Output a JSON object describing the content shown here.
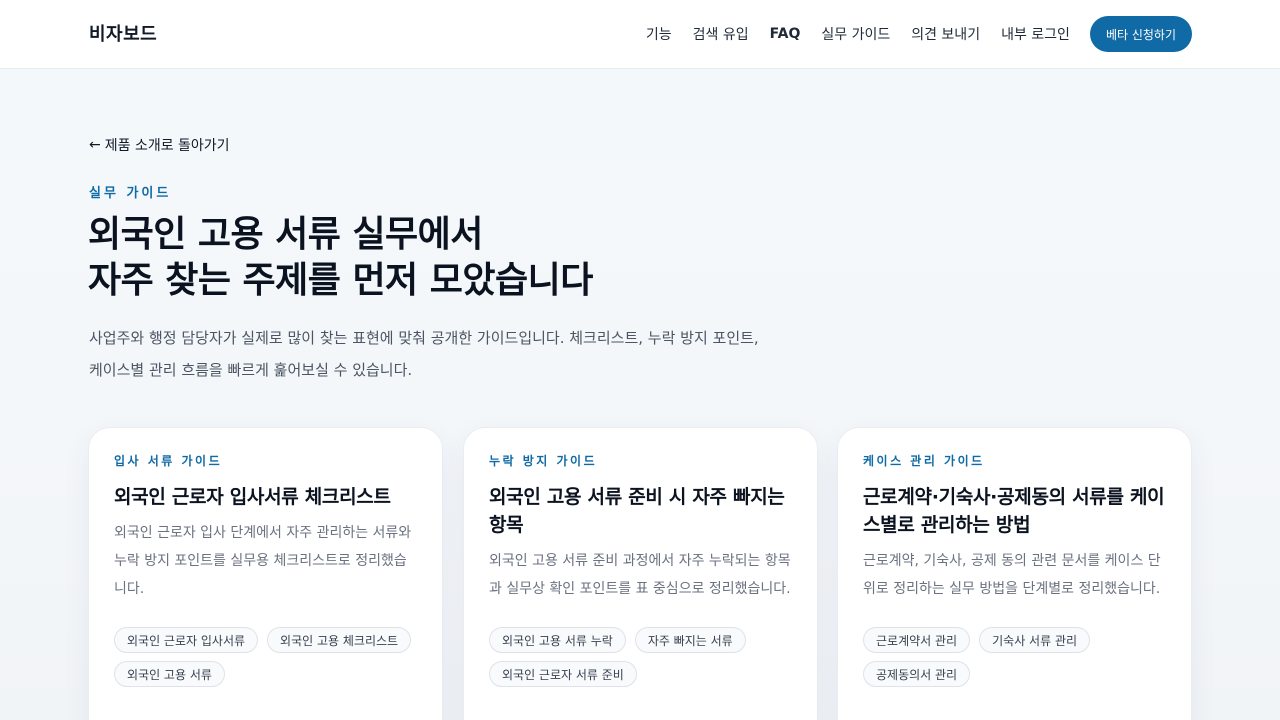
{
  "header": {
    "brand": "비자보드",
    "nav": [
      "기능",
      "검색 유입",
      "FAQ",
      "실무 가이드",
      "의견 보내기",
      "내부 로그인"
    ],
    "cta": "베타 신청하기"
  },
  "back_link": {
    "arrow": "←",
    "label": "제품 소개로 돌아가기"
  },
  "hero": {
    "eyebrow": "실무 가이드",
    "title_lines": [
      "외국인 고용 서류 실무에서",
      "자주 찾는 주제를 먼저 모았습니다"
    ],
    "intro_lines": [
      "사업주와 행정 담당자가 실제로 많이 찾는 표현에 맞춰 공개한 가이드입니다. 체크리스트, 누락 방지 포인트,",
      "케이스별 관리 흐름을 빠르게 훑어보실 수 있습니다."
    ]
  },
  "cards": [
    {
      "eyebrow": "입사 서류 가이드",
      "title": "외국인 근로자 입사서류 체크리스트",
      "desc": "외국인 근로자 입사 단계에서 자주 관리하는 서류와 누락 방지 포인트를 실무용 체크리스트로 정리했습니다.",
      "tags": [
        "외국인 근로자 입사서류",
        "외국인 고용 체크리스트",
        "외국인 고용 서류"
      ]
    },
    {
      "eyebrow": "누락 방지 가이드",
      "title": "외국인 고용 서류 준비 시 자주 빠지는 항목",
      "desc": "외국인 고용 서류 준비 과정에서 자주 누락되는 항목과 실무상 확인 포인트를 표 중심으로 정리했습니다.",
      "tags": [
        "외국인 고용 서류 누락",
        "자주 빠지는 서류",
        "외국인 근로자 서류 준비"
      ]
    },
    {
      "eyebrow": "케이스 관리 가이드",
      "title": "근로계약·기숙사·공제동의 서류를 케이스별로 관리하는 방법",
      "desc": "근로계약, 기숙사, 공제 동의 관련 문서를 케이스 단위로 정리하는 실무 방법을 단계별로 정리했습니다.",
      "tags": [
        "근로계약서 관리",
        "기숙사 서류 관리",
        "공제동의서 관리"
      ]
    }
  ]
}
